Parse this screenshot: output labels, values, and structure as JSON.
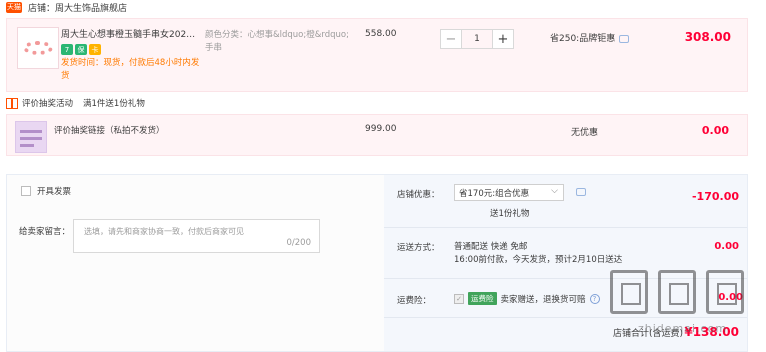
{
  "store": {
    "badge": "天猫",
    "name": "店铺：周大生饰品旗舰店"
  },
  "item1": {
    "title": "周大生心想事橙玉髓手串女202…",
    "icons": [
      {
        "name": "seven-day-return-icon",
        "glyph": "7",
        "color": "#2bb673"
      },
      {
        "name": "guarantee-icon",
        "glyph": "保",
        "color": "#2bb673"
      },
      {
        "name": "card-icon",
        "glyph": "卡",
        "color": "#ffb300"
      }
    ],
    "ship_note": "发货时间：现货，付款后48小时内发货",
    "sku": "颜色分类：心想事&ldquo;橙&rdquo;手串",
    "price": "558.00",
    "quantity": "1",
    "discount": "省250:品牌钜惠",
    "total": "308.00"
  },
  "promo": {
    "name": "评价抽奖活动",
    "rule": "满1件送1份礼物"
  },
  "item2": {
    "thumb_label": "评价抽奖",
    "title": "评价抽奖链接（私拍不发货）",
    "price": "999.00",
    "discount": "无优惠",
    "total": "0.00"
  },
  "invoice": {
    "label": "开具发票"
  },
  "message": {
    "label": "给卖家留言：",
    "placeholder": "选填，请先和商家协商一致，付款后商家可见",
    "count": "0/200"
  },
  "coupon": {
    "label": "店铺优惠：",
    "selected": "省170元:组合优惠",
    "note": "送1份礼物",
    "amount": "-170.00"
  },
  "shipping": {
    "label": "运送方式：",
    "line1": "普通配送 快递 免邮",
    "line2": "16:00前付款，今天发货，预计2月10日送达",
    "amount": "0.00"
  },
  "insurance": {
    "label": "运费险：",
    "badge": "运费险",
    "text": "卖家赠送，退换货可赔",
    "amount": "0.00"
  },
  "shop_total": {
    "label": "店铺合计(含运费)",
    "amount": "¥138.00"
  },
  "watermark": {
    "text": "zhidemai.com"
  }
}
